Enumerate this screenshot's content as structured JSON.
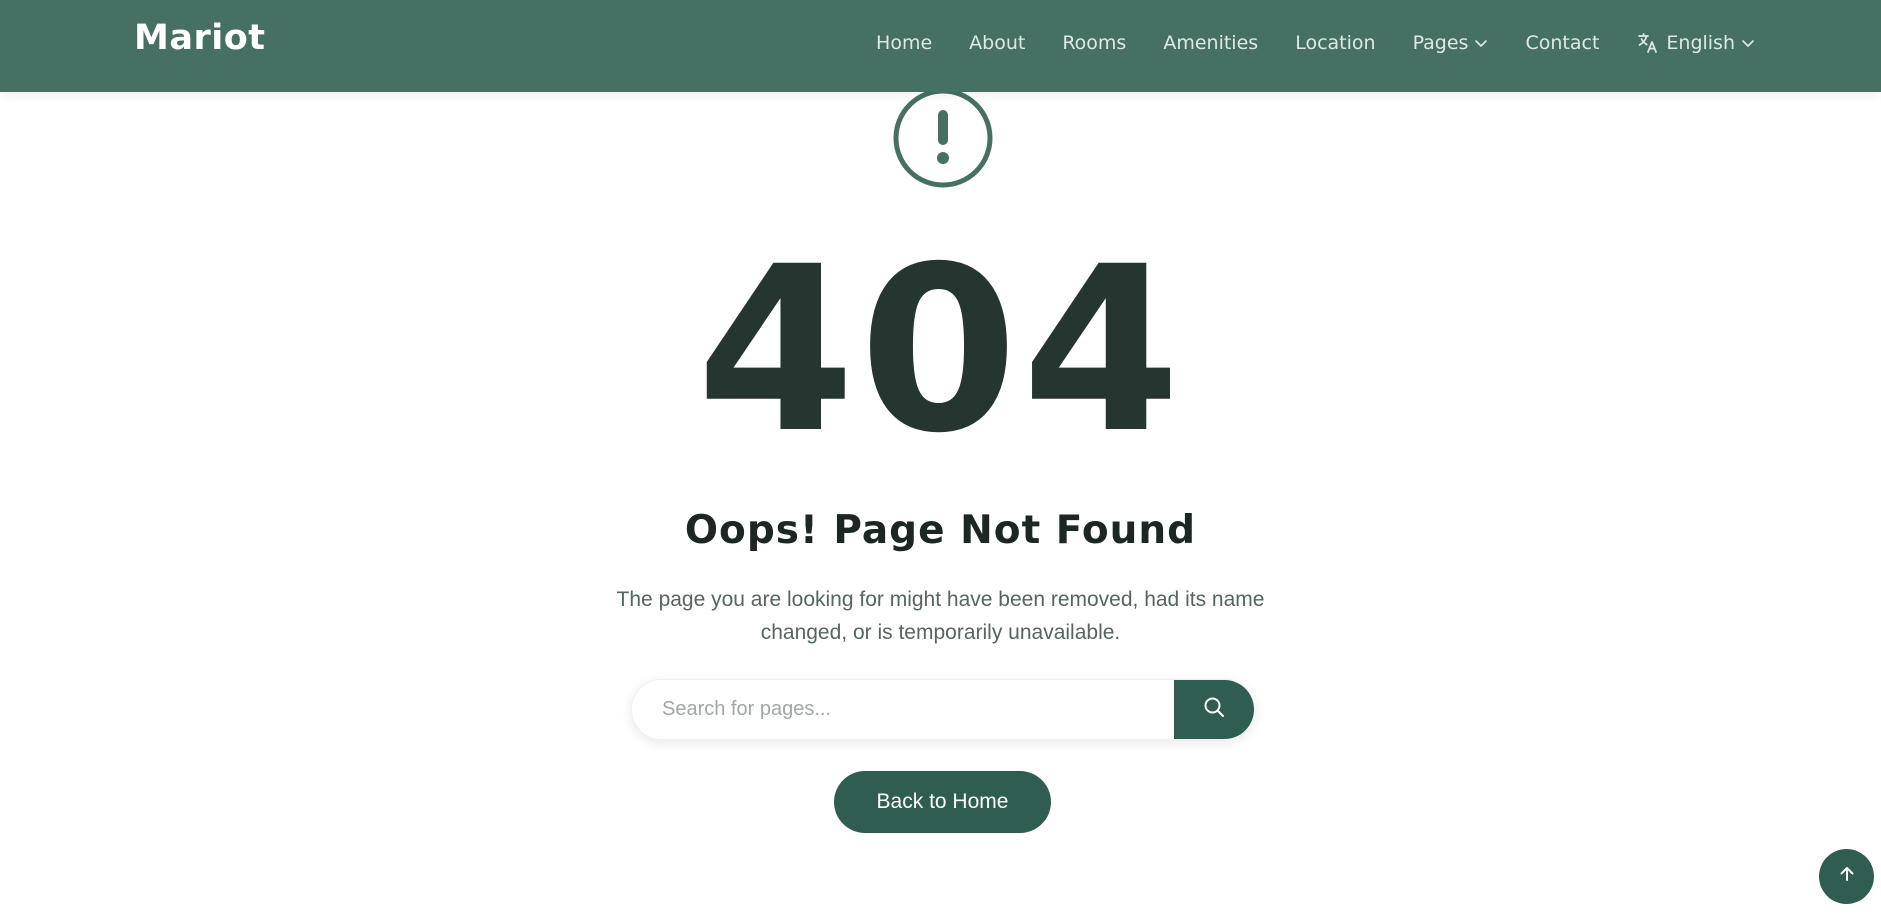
{
  "brand": {
    "logo_text": "Mariot",
    "accent_color": "#2f5d51",
    "header_color": "#467063"
  },
  "nav": {
    "items": [
      {
        "label": "Home"
      },
      {
        "label": "About"
      },
      {
        "label": "Rooms"
      },
      {
        "label": "Amenities"
      },
      {
        "label": "Location"
      },
      {
        "label": "Pages",
        "icon": "chevron-down-icon"
      }
    ],
    "contact_label": "Contact",
    "language": {
      "label": "English",
      "icon": "translate-icon"
    }
  },
  "error": {
    "icon": "exclamation-circle-icon",
    "code": "404",
    "title": "Oops! Page Not Found",
    "description": "The page you are looking for might have been removed, had its name changed, or is temporarily unavailable."
  },
  "search": {
    "placeholder": "Search for pages...",
    "icon": "search-icon"
  },
  "actions": {
    "back_home_label": "Back to Home",
    "scroll_top_icon": "arrow-up-icon"
  }
}
